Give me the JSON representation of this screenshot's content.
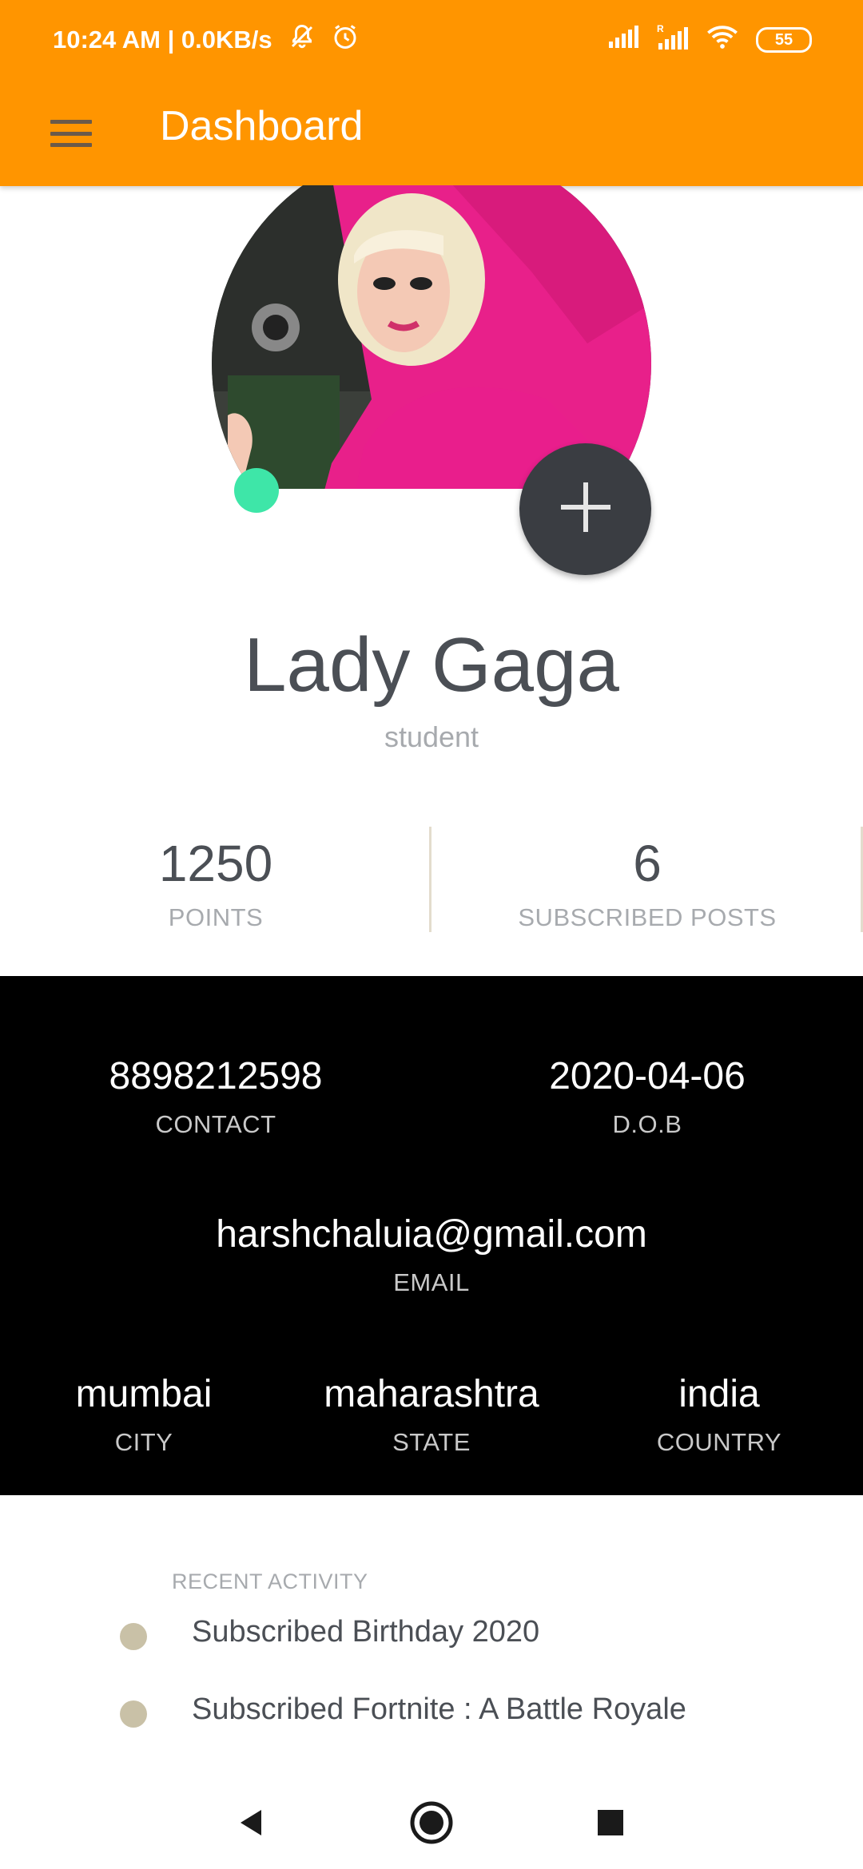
{
  "status_bar": {
    "time": "10:24 AM | 0.0KB/s",
    "battery": "55",
    "icons": [
      "mute-bell-icon",
      "alarm-icon",
      "signal-icon",
      "signal-roaming-icon",
      "wifi-icon",
      "battery-icon"
    ]
  },
  "app_bar": {
    "title": "Dashboard",
    "menu_icon": "hamburger-menu-icon",
    "background": "#FF9500"
  },
  "profile": {
    "name": "Lady Gaga",
    "role": "student",
    "online_color": "#3EE6A8",
    "add_icon": "plus-icon"
  },
  "stats": [
    {
      "value": "1250",
      "label": "POINTS"
    },
    {
      "value": "6",
      "label": "SUBSCRIBED POSTS"
    }
  ],
  "info": {
    "contact": {
      "value": "8898212598",
      "label": "CONTACT"
    },
    "dob": {
      "value": "2020-04-06",
      "label": "D.O.B"
    },
    "email": {
      "value": "harshchaluia@gmail.com",
      "label": "EMAIL"
    },
    "city": {
      "value": "mumbai",
      "label": "CITY"
    },
    "state": {
      "value": "maharashtra",
      "label": "STATE"
    },
    "country": {
      "value": "india",
      "label": "COUNTRY"
    }
  },
  "recent_activity": {
    "title": "RECENT ACTIVITY",
    "items": [
      {
        "text": "Subscribed Birthday 2020"
      },
      {
        "text": "Subscribed Fortnite : A Battle Royale"
      }
    ]
  },
  "nav": {
    "back_icon": "back-triangle-icon",
    "home_icon": "home-circle-icon",
    "recents_icon": "recents-square-icon"
  }
}
